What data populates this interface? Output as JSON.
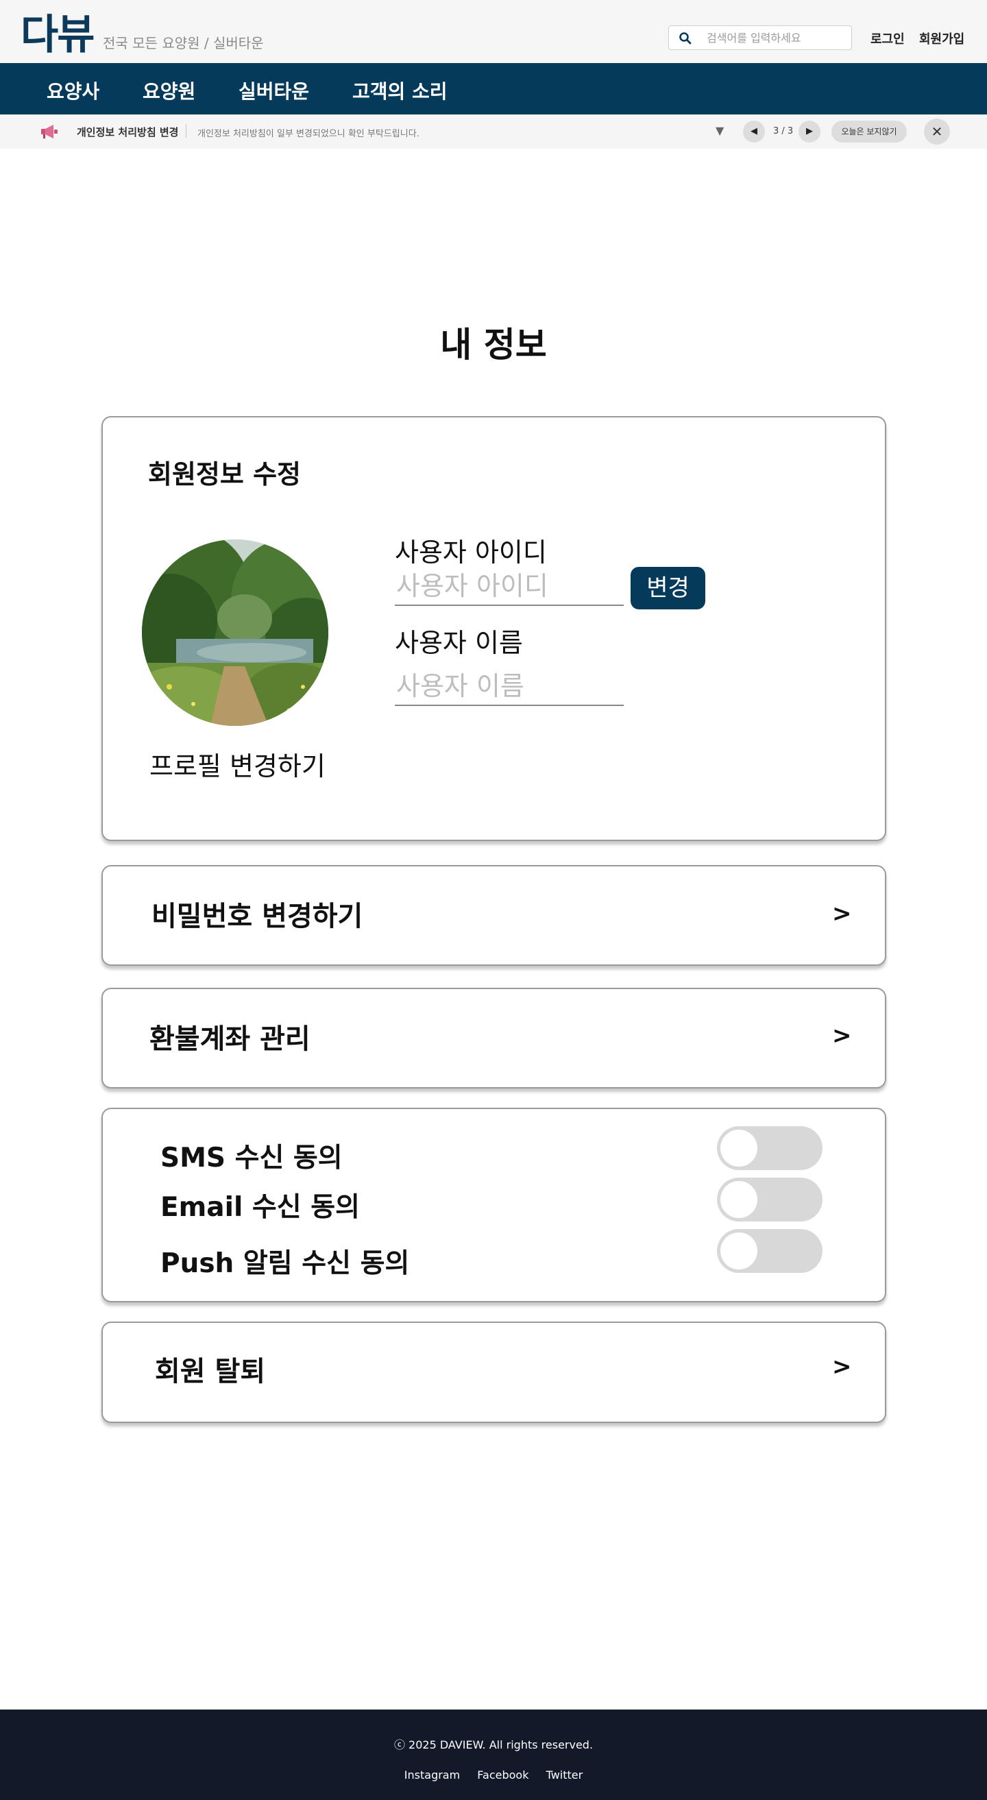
{
  "header": {
    "logo": "다뷰",
    "tagline": "전국 모든 요양원 / 실버타운",
    "search": {
      "placeholder": "검색어를 입력하세요",
      "value": ""
    },
    "login": "로그인",
    "signup": "회원가입"
  },
  "nav": {
    "items": [
      {
        "label": "요양사"
      },
      {
        "label": "요양원"
      },
      {
        "label": "실버타운"
      },
      {
        "label": "고객의 소리"
      }
    ]
  },
  "notice": {
    "title": "개인정보 처리방침 변경",
    "text": "개인정보 처리방침이 일부 변경되었으니 확인 부탁드립니다.",
    "expand": "▼",
    "prev": "◀",
    "next": "▶",
    "counter": "3 / 3",
    "hide_today": "오늘은 보지않기",
    "close": "✕"
  },
  "main": {
    "title": "내 정보",
    "profile": {
      "heading": "회원정보 수정",
      "change_profile": "프로필 변경하기",
      "user_id_label": "사용자 아이디",
      "user_id_placeholder": "사용자 아이디",
      "user_id_value": "",
      "change_button": "변경",
      "user_name_label": "사용자 이름",
      "user_name_placeholder": "사용자 이름",
      "user_name_value": ""
    },
    "password": {
      "label": "비밀번호 변경하기",
      "arrow": ">"
    },
    "refund": {
      "label": "환불계좌 관리",
      "arrow": ">"
    },
    "consents": [
      {
        "label": "SMS 수신 동의",
        "enabled": false
      },
      {
        "label": "Email 수신 동의",
        "enabled": false
      },
      {
        "label": "Push 알림 수신 동의",
        "enabled": false
      }
    ],
    "withdraw": {
      "label": "회원 탈퇴",
      "arrow": ">"
    }
  },
  "footer": {
    "copyright": "ⓒ 2025 DAVIEW. All rights reserved.",
    "links": [
      {
        "label": "Instagram"
      },
      {
        "label": "Facebook"
      },
      {
        "label": "Twitter"
      }
    ]
  },
  "colors": {
    "brand": "#063a5b",
    "footer_bg": "#121a2a",
    "toggle_off": "#d8d8d8"
  },
  "icons": {
    "search": "search-icon",
    "notice": "megaphone-icon",
    "close": "close-icon"
  }
}
